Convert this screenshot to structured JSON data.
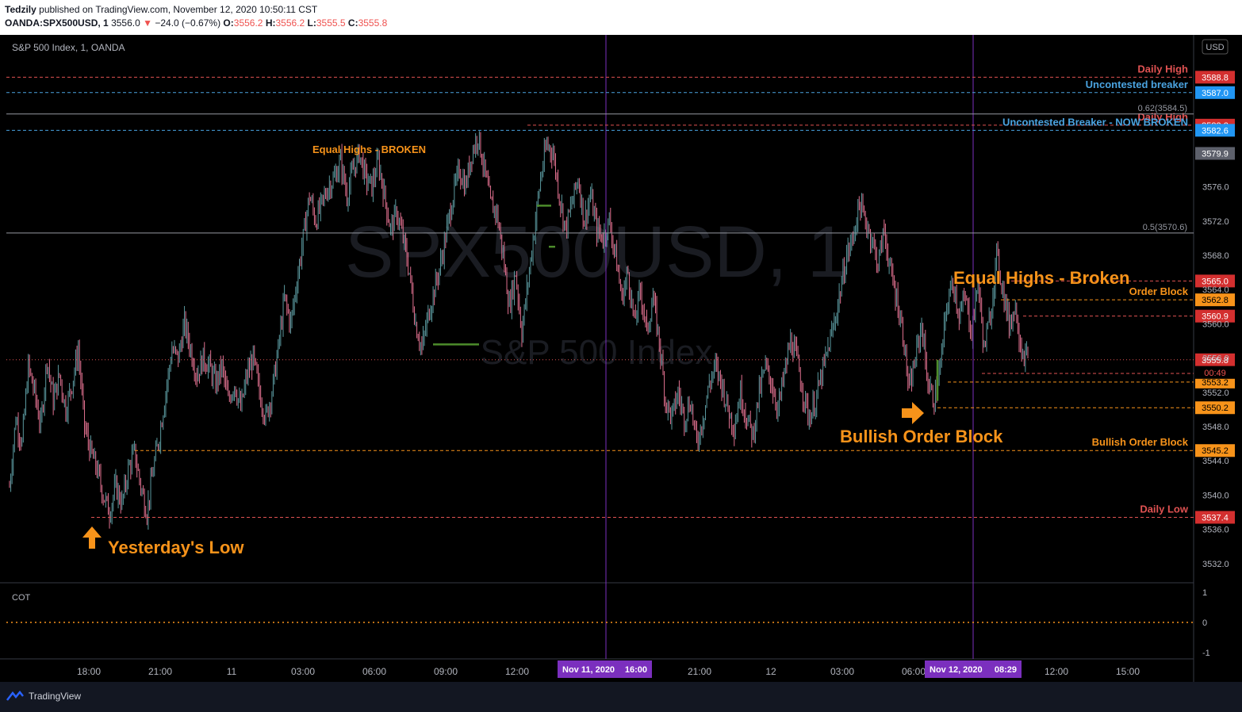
{
  "header": {
    "author": "Tedzily",
    "published_text": "published on TradingView.com, November 12, 2020 10:50:11 CST",
    "symbol": "OANDA:SPX500USD, 1",
    "last": "3556.0",
    "change": "−24.0 (−0.67%)",
    "o_label": "O:",
    "o": "3556.2",
    "h_label": "H:",
    "h": "3556.2",
    "l_label": "L:",
    "l": "3555.5",
    "c_label": "C:",
    "c": "3555.8"
  },
  "chart_title": "S&P 500 Index, 1, OANDA",
  "currency": "USD",
  "watermark": {
    "symbol": "SPX500USD, 1",
    "name": "S&P 500 Index"
  },
  "indicator_label": "COT",
  "colors": {
    "up": "#5b9aa0",
    "down": "#e0708f",
    "red_line": "#e05252",
    "blue_line": "#4aa3e0",
    "orange_line": "#f7931a",
    "purple": "#7b2fbe",
    "green": "#4c8c2b"
  },
  "chart_data": {
    "type": "candlestick",
    "title": "S&P 500 Index, 1, OANDA",
    "y_range": [
      3530.5,
      3593
    ],
    "y_ticks": [
      "3576.0",
      "3572.0",
      "3568.0",
      "3564.0",
      "3560.0",
      "3556.0",
      "3552.0",
      "3548.0",
      "3544.0",
      "3540.0",
      "3536.0",
      "3532.0"
    ],
    "x_ticks": [
      "18:00",
      "21:00",
      "11",
      "03:00",
      "06:00",
      "09:00",
      "12:00",
      "21:00",
      "12",
      "03:00",
      "06:00",
      "12:00",
      "15:00"
    ],
    "time_markers": [
      {
        "date": "Nov 11, 2020",
        "time": "16:00"
      },
      {
        "date": "Nov 12, 2020",
        "time": "08:29"
      }
    ],
    "price_levels": [
      {
        "label": "Daily High",
        "value": 3588.8,
        "tag": "3588.8",
        "color": "red"
      },
      {
        "label": "Uncontested breaker",
        "value": 3587.0,
        "tag": "3587.0",
        "color": "blue"
      },
      {
        "label": "Daily High",
        "value": 3583.2,
        "tag": "3583.2",
        "color": "red"
      },
      {
        "label": "Uncontested Breaker - NOW BROKEN",
        "value": 3582.6,
        "tag": "3582.6",
        "color": "blue"
      },
      {
        "label": "",
        "value": 3579.9,
        "tag": "3579.9",
        "color": "gray"
      },
      {
        "label": "",
        "value": 3565.0,
        "tag": "3565.0",
        "color": "red"
      },
      {
        "label": "Order Block",
        "value": 3562.8,
        "tag": "3562.8",
        "color": "orange"
      },
      {
        "label": "",
        "value": 3560.9,
        "tag": "3560.9",
        "color": "red"
      },
      {
        "label": "",
        "value": 3555.8,
        "tag": "3555.8",
        "color": "red"
      },
      {
        "label": "",
        "value": 3554.2,
        "tag": "3554.2",
        "color": "red"
      },
      {
        "label": "",
        "value": 3553.2,
        "tag": "3553.2",
        "color": "orange"
      },
      {
        "label": "",
        "value": 3550.2,
        "tag": "3550.2",
        "color": "orange"
      },
      {
        "label": "Bullish Order Block",
        "value": 3545.2,
        "tag": "3545.2",
        "color": "orange"
      },
      {
        "label": "Daily Low",
        "value": 3537.4,
        "tag": "3537.4",
        "color": "red"
      }
    ],
    "fib_levels": [
      {
        "label": "0.62(3584.5)",
        "value": 3584.5
      },
      {
        "label": "0.5(3570.6)",
        "value": 3570.6
      }
    ],
    "countdown": "00:49",
    "annotations": [
      {
        "text": "Equal Highs - BROKEN",
        "size": "small"
      },
      {
        "text": "Equal Highs - Broken",
        "size": "large"
      },
      {
        "text": "Bullish Order Block",
        "size": "large"
      },
      {
        "text": "Yesterday's Low",
        "size": "large"
      }
    ],
    "indicator": {
      "name": "COT",
      "y_ticks": [
        "1",
        "0",
        "-1"
      ]
    },
    "price_path": [
      3541,
      3549,
      3546,
      3555,
      3552,
      3548,
      3556,
      3551,
      3554,
      3550,
      3553,
      3557,
      3548,
      3545,
      3543,
      3540,
      3538,
      3541,
      3539,
      3543,
      3545,
      3541,
      3538,
      3543,
      3547,
      3552,
      3557,
      3556,
      3560,
      3557,
      3554,
      3556,
      3555,
      3553,
      3555,
      3551,
      3553,
      3550,
      3554,
      3556,
      3552,
      3549,
      3552,
      3557,
      3563,
      3560,
      3565,
      3570,
      3575,
      3572,
      3574,
      3576,
      3577,
      3579,
      3575,
      3578,
      3580,
      3577,
      3576,
      3579,
      3575,
      3571,
      3573,
      3570,
      3566,
      3560,
      3557,
      3561,
      3564,
      3567,
      3571,
      3575,
      3578,
      3576,
      3580,
      3582,
      3578,
      3574,
      3573,
      3568,
      3562,
      3566,
      3559,
      3565,
      3571,
      3577,
      3581,
      3580,
      3575,
      3571,
      3574,
      3577,
      3572,
      3575,
      3571,
      3570,
      3572,
      3568,
      3563,
      3566,
      3560,
      3564,
      3559,
      3563,
      3558,
      3551,
      3549,
      3552,
      3549,
      3551,
      3546,
      3549,
      3553,
      3555,
      3553,
      3550,
      3548,
      3552,
      3549,
      3547,
      3552,
      3555,
      3553,
      3550,
      3554,
      3558,
      3556,
      3552,
      3549,
      3551,
      3554,
      3557,
      3560,
      3564,
      3568,
      3570,
      3574,
      3572,
      3570,
      3567,
      3571,
      3566,
      3563,
      3559,
      3552,
      3556,
      3560,
      3553,
      3551,
      3555,
      3562,
      3565,
      3561,
      3563,
      3559,
      3565,
      3557,
      3561,
      3568,
      3564,
      3560,
      3562,
      3557,
      3555.8
    ]
  }
}
